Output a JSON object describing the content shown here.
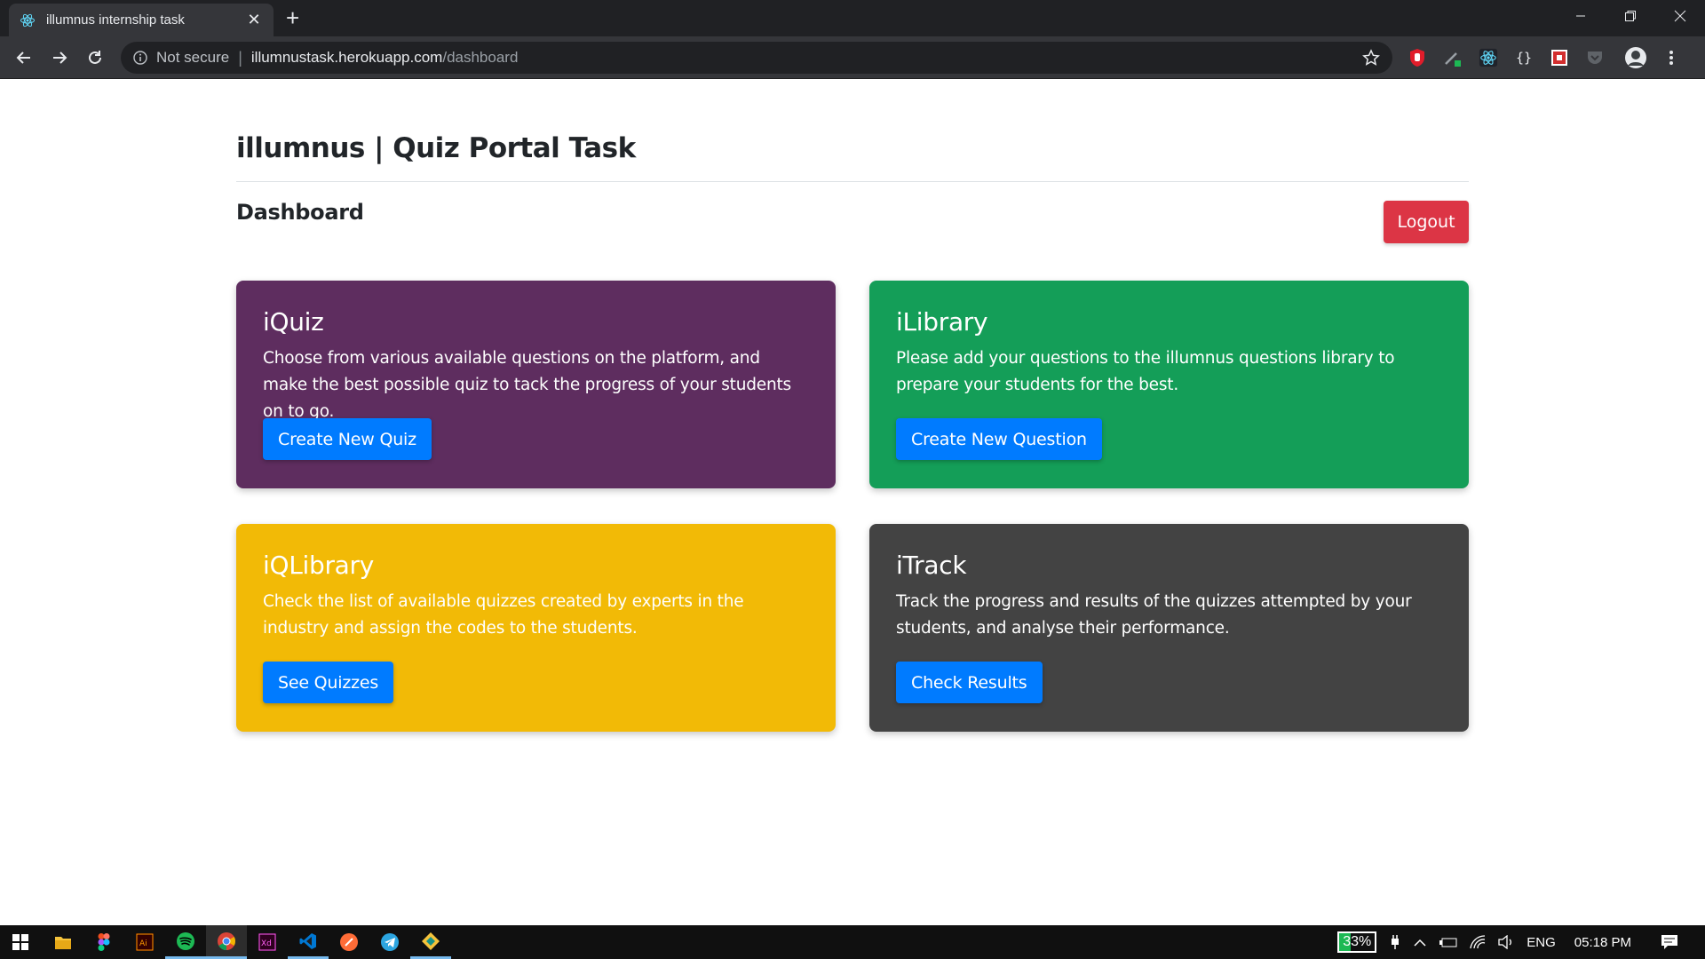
{
  "browser": {
    "tab_title": "illumnus internship task",
    "new_tab": "+",
    "security": "Not secure",
    "separator": "|",
    "url_host": "illumnustask.herokuapp.com",
    "url_path": "/dashboard"
  },
  "page": {
    "site_title": "illumnus | Quiz Portal Task",
    "dashboard_title": "Dashboard",
    "logout_label": "Logout",
    "cards": [
      {
        "title": "iQuiz",
        "text": "Choose from various available questions on the platform, and make the best possible quiz to tack the progress of your students on to go.",
        "button": "Create New Quiz",
        "color": "#5e2d5f"
      },
      {
        "title": "iLibrary",
        "text": "Please add your questions to the illumnus questions library to prepare your students for the best.",
        "button": "Create New Question",
        "color": "#149e58"
      },
      {
        "title": "iQLibrary",
        "text": "Check the list of available quizzes created by experts in the industry and assign the codes to the students.",
        "button": "See Quizzes",
        "color": "#f2ba06"
      },
      {
        "title": "iTrack",
        "text": "Track the progress and results of the quizzes attempted by your students, and analyse their performance.",
        "button": "Check Results",
        "color": "#434343"
      }
    ]
  },
  "taskbar": {
    "battery": "33%",
    "language": "ENG",
    "time": "05:18 PM"
  },
  "colors": {
    "primary_button": "#007bff",
    "logout": "#dc3545"
  }
}
